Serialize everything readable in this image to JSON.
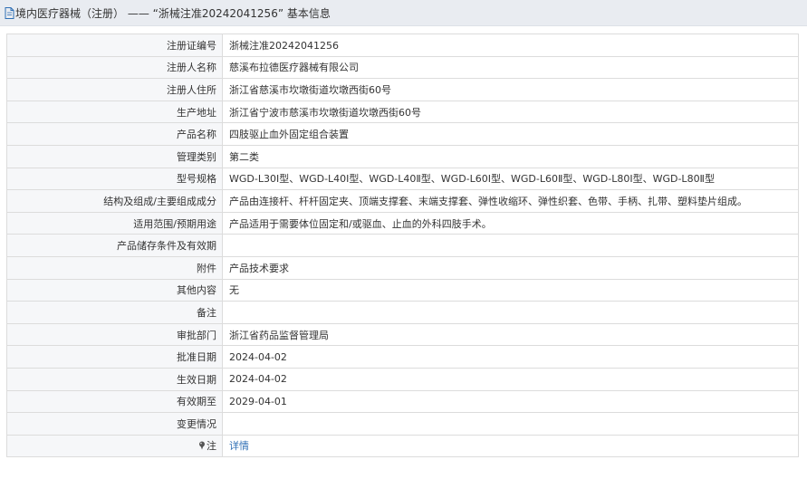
{
  "header": {
    "title": "境内医疗器械（注册） ——  “浙械注准20242041256” 基本信息"
  },
  "rows": [
    {
      "label": "注册证编号",
      "value": "浙械注准20242041256"
    },
    {
      "label": "注册人名称",
      "value": "慈溪布拉德医疗器械有限公司"
    },
    {
      "label": "注册人住所",
      "value": "浙江省慈溪市坎墩街道坎墩西街60号"
    },
    {
      "label": "生产地址",
      "value": "浙江省宁波市慈溪市坎墩街道坎墩西街60号"
    },
    {
      "label": "产品名称",
      "value": "四肢驱止血外固定组合装置"
    },
    {
      "label": "管理类别",
      "value": "第二类"
    },
    {
      "label": "型号规格",
      "value": "WGD-L30Ⅰ型、WGD-L40Ⅰ型、WGD-L40Ⅱ型、WGD-L60Ⅰ型、WGD-L60Ⅱ型、WGD-L80Ⅰ型、WGD-L80Ⅱ型"
    },
    {
      "label": "结构及组成/主要组成成分",
      "value": "产品由连接杆、杆杆固定夹、顶端支撑套、末端支撑套、弹性收缩环、弹性织套、色带、手柄、扎带、塑料垫片组成。"
    },
    {
      "label": "适用范围/预期用途",
      "value": "产品适用于需要体位固定和/或驱血、止血的外科四肢手术。"
    },
    {
      "label": "产品储存条件及有效期",
      "value": ""
    },
    {
      "label": "附件",
      "value": "产品技术要求"
    },
    {
      "label": "其他内容",
      "value": "无"
    },
    {
      "label": "备注",
      "value": ""
    },
    {
      "label": "审批部门",
      "value": "浙江省药品监督管理局"
    },
    {
      "label": "批准日期",
      "value": "2024-04-02"
    },
    {
      "label": "生效日期",
      "value": "2024-04-02"
    },
    {
      "label": "有效期至",
      "value": "2029-04-01"
    },
    {
      "label": "变更情况",
      "value": ""
    }
  ],
  "note": {
    "label": "注",
    "link_text": "详情",
    "icon": "pin-icon"
  },
  "colors": {
    "header_bg": "#e9ecf1",
    "label_bg": "#f6f7f9",
    "border": "#dcdcdc",
    "link": "#2f6fb5"
  }
}
